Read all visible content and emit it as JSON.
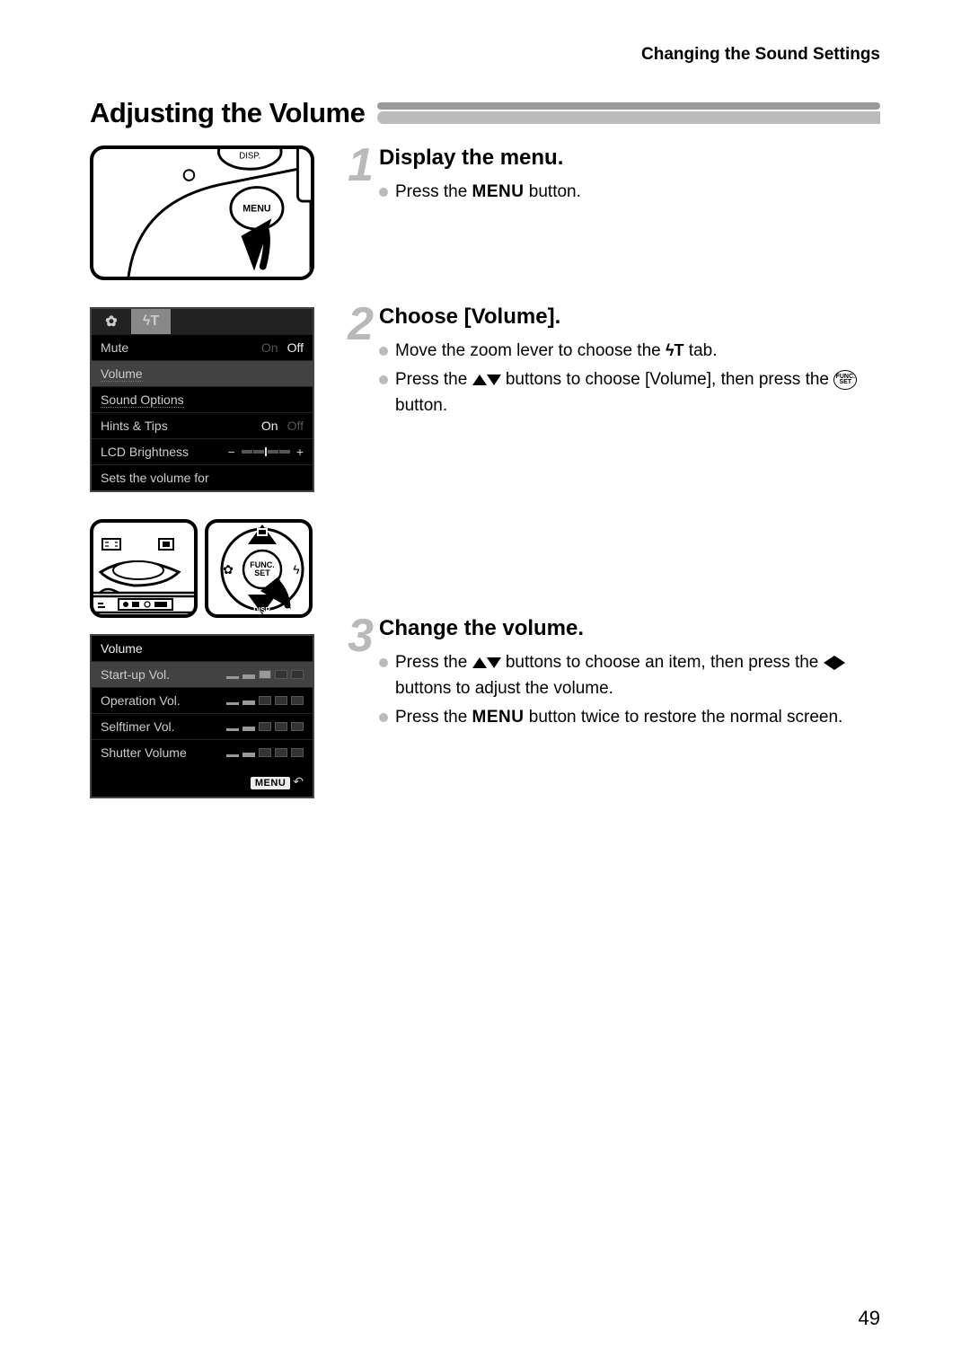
{
  "header": {
    "breadcrumb": "Changing the Sound Settings"
  },
  "section_title": "Adjusting the Volume",
  "page_number": "49",
  "lcd_menu": {
    "rows": {
      "mute": {
        "label": "Mute",
        "value_off": "Off",
        "value_on": "On"
      },
      "volume": {
        "label": "Volume"
      },
      "sound_options": {
        "label": "Sound Options"
      },
      "hints": {
        "label": "Hints & Tips",
        "value_on": "On",
        "value_off": "Off"
      },
      "brightness": {
        "label": "LCD Brightness"
      }
    },
    "footer": "Sets the volume for"
  },
  "lcd_volume": {
    "title": "Volume",
    "rows": {
      "startup": {
        "label": "Start-up Vol."
      },
      "operation": {
        "label": "Operation Vol."
      },
      "selftimer": {
        "label": "Selftimer Vol."
      },
      "shutter": {
        "label": "Shutter Volume"
      }
    },
    "footer_badge": "MENU"
  },
  "steps": {
    "s1": {
      "num": "1",
      "title": "Display the menu.",
      "b1_a": "Press the ",
      "b1_menu": "MENU",
      "b1_b": " button."
    },
    "s2": {
      "num": "2",
      "title": "Choose [Volume].",
      "b1_a": "Move the zoom lever to choose the ",
      "b1_b": " tab.",
      "b2_a": "Press the ",
      "b2_b": " buttons to choose [Volume], then press the ",
      "b2_c": " button.",
      "func_top": "FUNC.",
      "func_bot": "SET"
    },
    "s3": {
      "num": "3",
      "title": "Change the volume.",
      "b1_a": "Press the ",
      "b1_b": " buttons to choose an item, then press the ",
      "b1_c": " buttons to adjust the volume.",
      "b2_a": "Press the ",
      "b2_menu": "MENU",
      "b2_b": " button twice to restore the normal screen."
    }
  }
}
